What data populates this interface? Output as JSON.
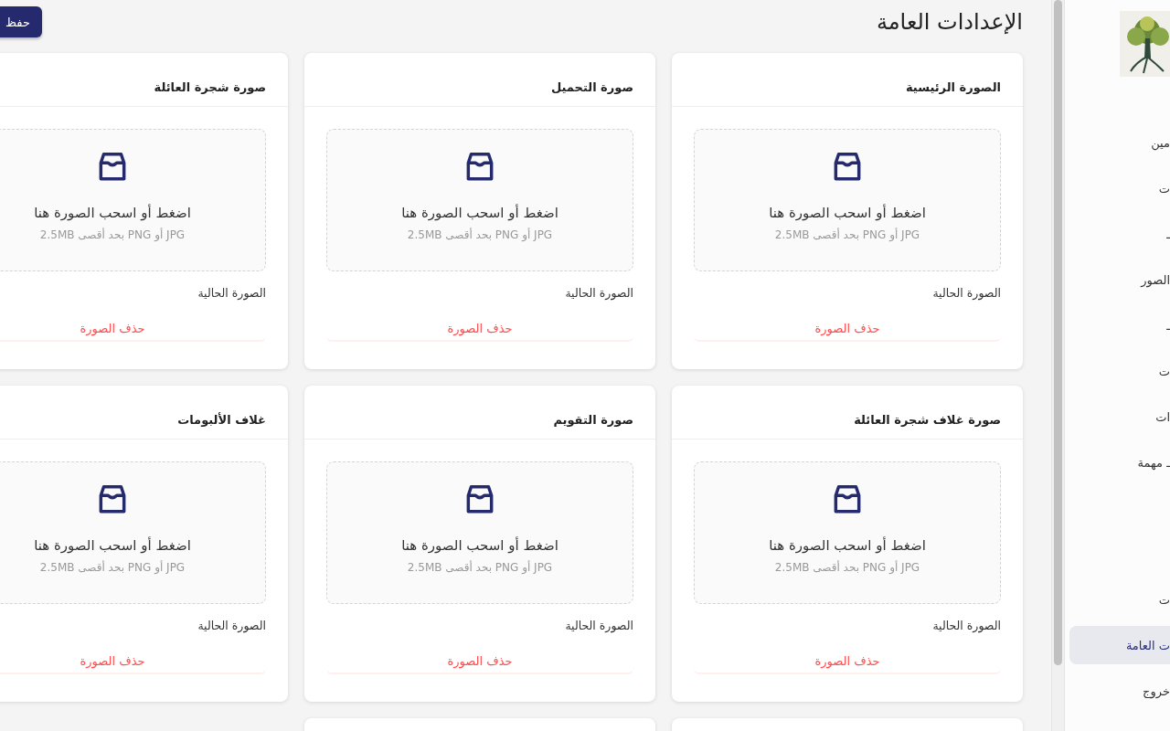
{
  "page_title": "الإعدادات العامة",
  "save_button": "حفظ",
  "cards": [
    {
      "title": "الصورة الرئيسية",
      "upload_text": "اضغط أو اسحب الصورة هنا",
      "hint": "JPG أو PNG بحد أقصى 2.5MB",
      "current_label": "الصورة الحالية",
      "delete_label": "حذف الصورة"
    },
    {
      "title": "صورة التحميل",
      "upload_text": "اضغط أو اسحب الصورة هنا",
      "hint": "JPG أو PNG بحد أقصى 2.5MB",
      "current_label": "الصورة الحالية",
      "delete_label": "حذف الصورة"
    },
    {
      "title": "صورة شجرة العائلة",
      "upload_text": "اضغط أو اسحب الصورة هنا",
      "hint": "JPG أو PNG بحد أقصى 2.5MB",
      "current_label": "الصورة الحالية",
      "delete_label": "حذف الصورة"
    },
    {
      "title": "صورة غلاف شجرة العائلة",
      "upload_text": "اضغط أو اسحب الصورة هنا",
      "hint": "JPG أو PNG بحد أقصى 2.5MB",
      "current_label": "الصورة الحالية",
      "delete_label": "حذف الصورة"
    },
    {
      "title": "صورة التقويم",
      "upload_text": "اضغط أو اسحب الصورة هنا",
      "hint": "JPG أو PNG بحد أقصى 2.5MB",
      "current_label": "الصورة الحالية",
      "delete_label": "حذف الصورة"
    },
    {
      "title": "غلاف الألبومات",
      "upload_text": "اضغط أو اسحب الصورة هنا",
      "hint": "JPG أو PNG بحد أقصى 2.5MB",
      "current_label": "الصورة الحالية",
      "delete_label": "حذف الصورة"
    }
  ],
  "more_cards": [
    {
      "kind": "cut"
    },
    {
      "kind": "cut"
    }
  ],
  "sidebar": {
    "groups": [
      {
        "items": [
          {
            "label": "مين",
            "selected": false
          },
          {
            "label": "ت",
            "selected": false
          },
          {
            "label": "ـ",
            "selected": false
          },
          {
            "label": "الصور",
            "selected": false
          },
          {
            "label": "ـ",
            "selected": false
          },
          {
            "label": "ت",
            "selected": false
          },
          {
            "label": "ات",
            "selected": false
          },
          {
            "label": "ـ مهمة",
            "selected": false
          }
        ]
      },
      {
        "items": [
          {
            "label": "ت",
            "selected": false
          },
          {
            "label": "ت العامة",
            "selected": true
          },
          {
            "label": "خروج",
            "selected": false
          }
        ]
      }
    ]
  }
}
